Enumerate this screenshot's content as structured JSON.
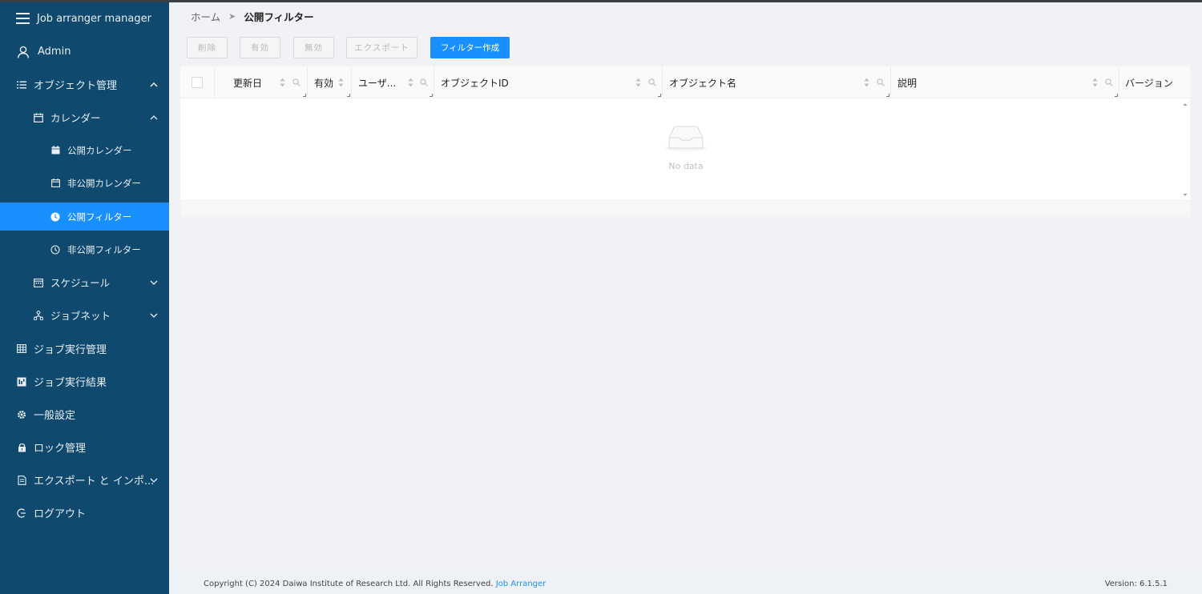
{
  "app": {
    "title": "Job arranger manager"
  },
  "sidebar": {
    "user": "Admin",
    "items": [
      {
        "label": "オブジェクト管理"
      },
      {
        "label": "カレンダー"
      },
      {
        "label": "公開カレンダー"
      },
      {
        "label": "非公開カレンダー"
      },
      {
        "label": "公開フィルター"
      },
      {
        "label": "非公開フィルター"
      },
      {
        "label": "スケジュール"
      },
      {
        "label": "ジョブネット"
      },
      {
        "label": "ジョブ実行管理"
      },
      {
        "label": "ジョブ実行結果"
      },
      {
        "label": "一般設定"
      },
      {
        "label": "ロック管理"
      },
      {
        "label": "エクスポート と インポ..."
      },
      {
        "label": "ログアウト"
      }
    ],
    "active_color": "#1890ff",
    "bg_color": "#0f4a6e"
  },
  "breadcrumb": {
    "home": "ホーム",
    "separator": "➤",
    "current": "公開フィルター"
  },
  "toolbar": {
    "delete_label": "削除",
    "enable_label": "有効",
    "disable_label": "無効",
    "export_label": "エクスポート",
    "create_label": "フィルター作成"
  },
  "table": {
    "columns": [
      "更新日",
      "有効",
      "ユーザ...",
      "オブジェクトID",
      "オブジェクト名",
      "説明",
      "バージョン"
    ],
    "rows": [],
    "empty_text": "No data"
  },
  "footer": {
    "copyright": "Copyright (C) 2024 Daiwa Institute of Research Ltd. All Rights Reserved.",
    "link_text": "Job Arranger",
    "version": "Version: 6.1.5.1"
  }
}
